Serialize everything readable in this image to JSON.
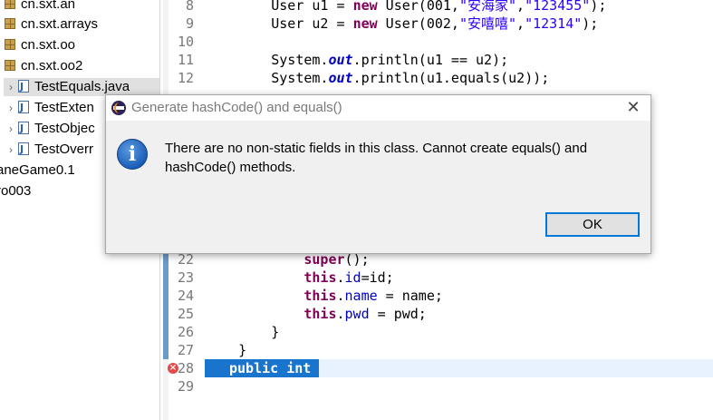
{
  "explorer": {
    "items": [
      {
        "label": "cn.sxt.an",
        "type": "package"
      },
      {
        "label": "cn.sxt.arrays",
        "type": "package"
      },
      {
        "label": "cn.sxt.oo",
        "type": "package"
      },
      {
        "label": "cn.sxt.oo2",
        "type": "package"
      },
      {
        "label": "TestEquals.java",
        "type": "file",
        "selected": true
      },
      {
        "label": "TestExten",
        "type": "file"
      },
      {
        "label": "TestObjec",
        "type": "file"
      },
      {
        "label": "TestOverr",
        "type": "file"
      },
      {
        "label": "aneGame0.1",
        "type": "project"
      },
      {
        "label": "ro003",
        "type": "project"
      }
    ]
  },
  "editor": {
    "lines": [
      {
        "num": "8",
        "parts": [
          [
            "",
            "        User u1 = "
          ],
          [
            "kw",
            "new"
          ],
          [
            "",
            " User(001,"
          ],
          [
            "str",
            "\"安海家\""
          ],
          [
            "",
            ","
          ],
          [
            "str",
            "\"123455\""
          ],
          [
            "",
            ");"
          ]
        ]
      },
      {
        "num": "9",
        "parts": [
          [
            "",
            "        User u2 = "
          ],
          [
            "kw",
            "new"
          ],
          [
            "",
            " User(002,"
          ],
          [
            "str",
            "\"安嘻嘻\""
          ],
          [
            "",
            ","
          ],
          [
            "str",
            "\"12314\""
          ],
          [
            "",
            ");"
          ]
        ]
      },
      {
        "num": "10",
        "parts": []
      },
      {
        "num": "11",
        "parts": [
          [
            "",
            "        System."
          ],
          [
            "sfld",
            "out"
          ],
          [
            "",
            ".println(u1 == u2);"
          ]
        ]
      },
      {
        "num": "12",
        "parts": [
          [
            "",
            "        System."
          ],
          [
            "sfld",
            "out"
          ],
          [
            "",
            ".println(u1.equals(u2));"
          ]
        ]
      },
      {
        "num": "22",
        "parts": [
          [
            "",
            "            "
          ],
          [
            "kw",
            "super"
          ],
          [
            "",
            "();"
          ]
        ]
      },
      {
        "num": "23",
        "parts": [
          [
            "",
            "            "
          ],
          [
            "kw",
            "this"
          ],
          [
            "",
            "."
          ],
          [
            "fld",
            "id"
          ],
          [
            "",
            "=id;"
          ]
        ]
      },
      {
        "num": "24",
        "parts": [
          [
            "",
            "            "
          ],
          [
            "kw",
            "this"
          ],
          [
            "",
            "."
          ],
          [
            "fld",
            "name"
          ],
          [
            "",
            " = name;"
          ]
        ]
      },
      {
        "num": "25",
        "parts": [
          [
            "",
            "            "
          ],
          [
            "kw",
            "this"
          ],
          [
            "",
            "."
          ],
          [
            "fld",
            "pwd"
          ],
          [
            "",
            " = pwd;"
          ]
        ]
      },
      {
        "num": "26",
        "parts": [
          [
            "",
            "        }"
          ]
        ]
      },
      {
        "num": "27",
        "parts": [
          [
            "",
            "    }"
          ]
        ]
      },
      {
        "num": "28",
        "parts": [],
        "error": true,
        "current": true
      },
      {
        "num": "29",
        "parts": []
      }
    ],
    "autocomplete_text": "public int"
  },
  "dialog": {
    "title": "Generate hashCode() and equals()",
    "message_line1": "There are no non-static fields in this class. Cannot create equals() and",
    "message_line2": "hashCode() methods.",
    "ok_label": "OK",
    "close_symbol": "✕",
    "info_symbol": "i"
  },
  "colors": {
    "keyword": "#7f0055",
    "string": "#2a00ff",
    "field": "#0000c0",
    "selection": "#1874cd",
    "button_focus": "#0078d7"
  }
}
